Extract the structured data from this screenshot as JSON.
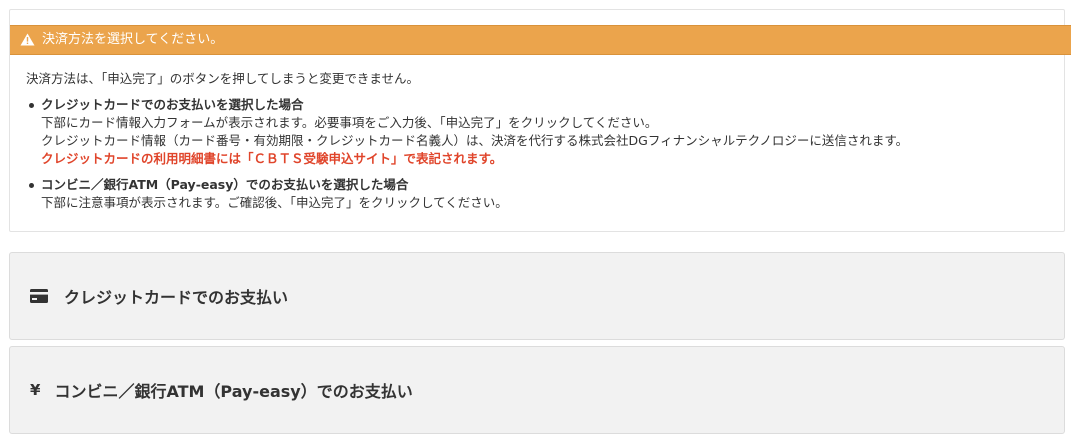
{
  "notice": {
    "header": "決済方法を選択してください。",
    "intro": "決済方法は、「申込完了」のボタンを押してしまうと変更できません。",
    "items": [
      {
        "title": "クレジットカードでのお支払いを選択した場合",
        "lines": [
          "下部にカード情報入力フォームが表示されます。必要事項をご入力後、「申込完了」をクリックしてください。",
          "クレジットカード情報（カード番号・有効期限・クレジットカード名義人）は、決済を代行する株式会社DGフィナンシャルテクノロジーに送信されます。"
        ],
        "highlight": "クレジットカードの利用明細書には「ＣＢＴＳ受験申込サイト」で表記されます。"
      },
      {
        "title": "コンビニ／銀行ATM（Pay-easy）でのお支払いを選択した場合",
        "lines": [
          "下部に注意事項が表示されます。ご確認後、「申込完了」をクリックしてください。"
        ]
      }
    ]
  },
  "payment_options": {
    "card": {
      "icon": "credit-card-icon",
      "label": "クレジットカードでのお支払い"
    },
    "convenience": {
      "icon": "yen-icon",
      "icon_glyph": "¥",
      "label": "コンビニ／銀行ATM（Pay-easy）でのお支払い"
    }
  },
  "colors": {
    "header_bg": "#eba44c",
    "highlight_text": "#e0452b",
    "panel_bg": "#f2f2f2"
  }
}
